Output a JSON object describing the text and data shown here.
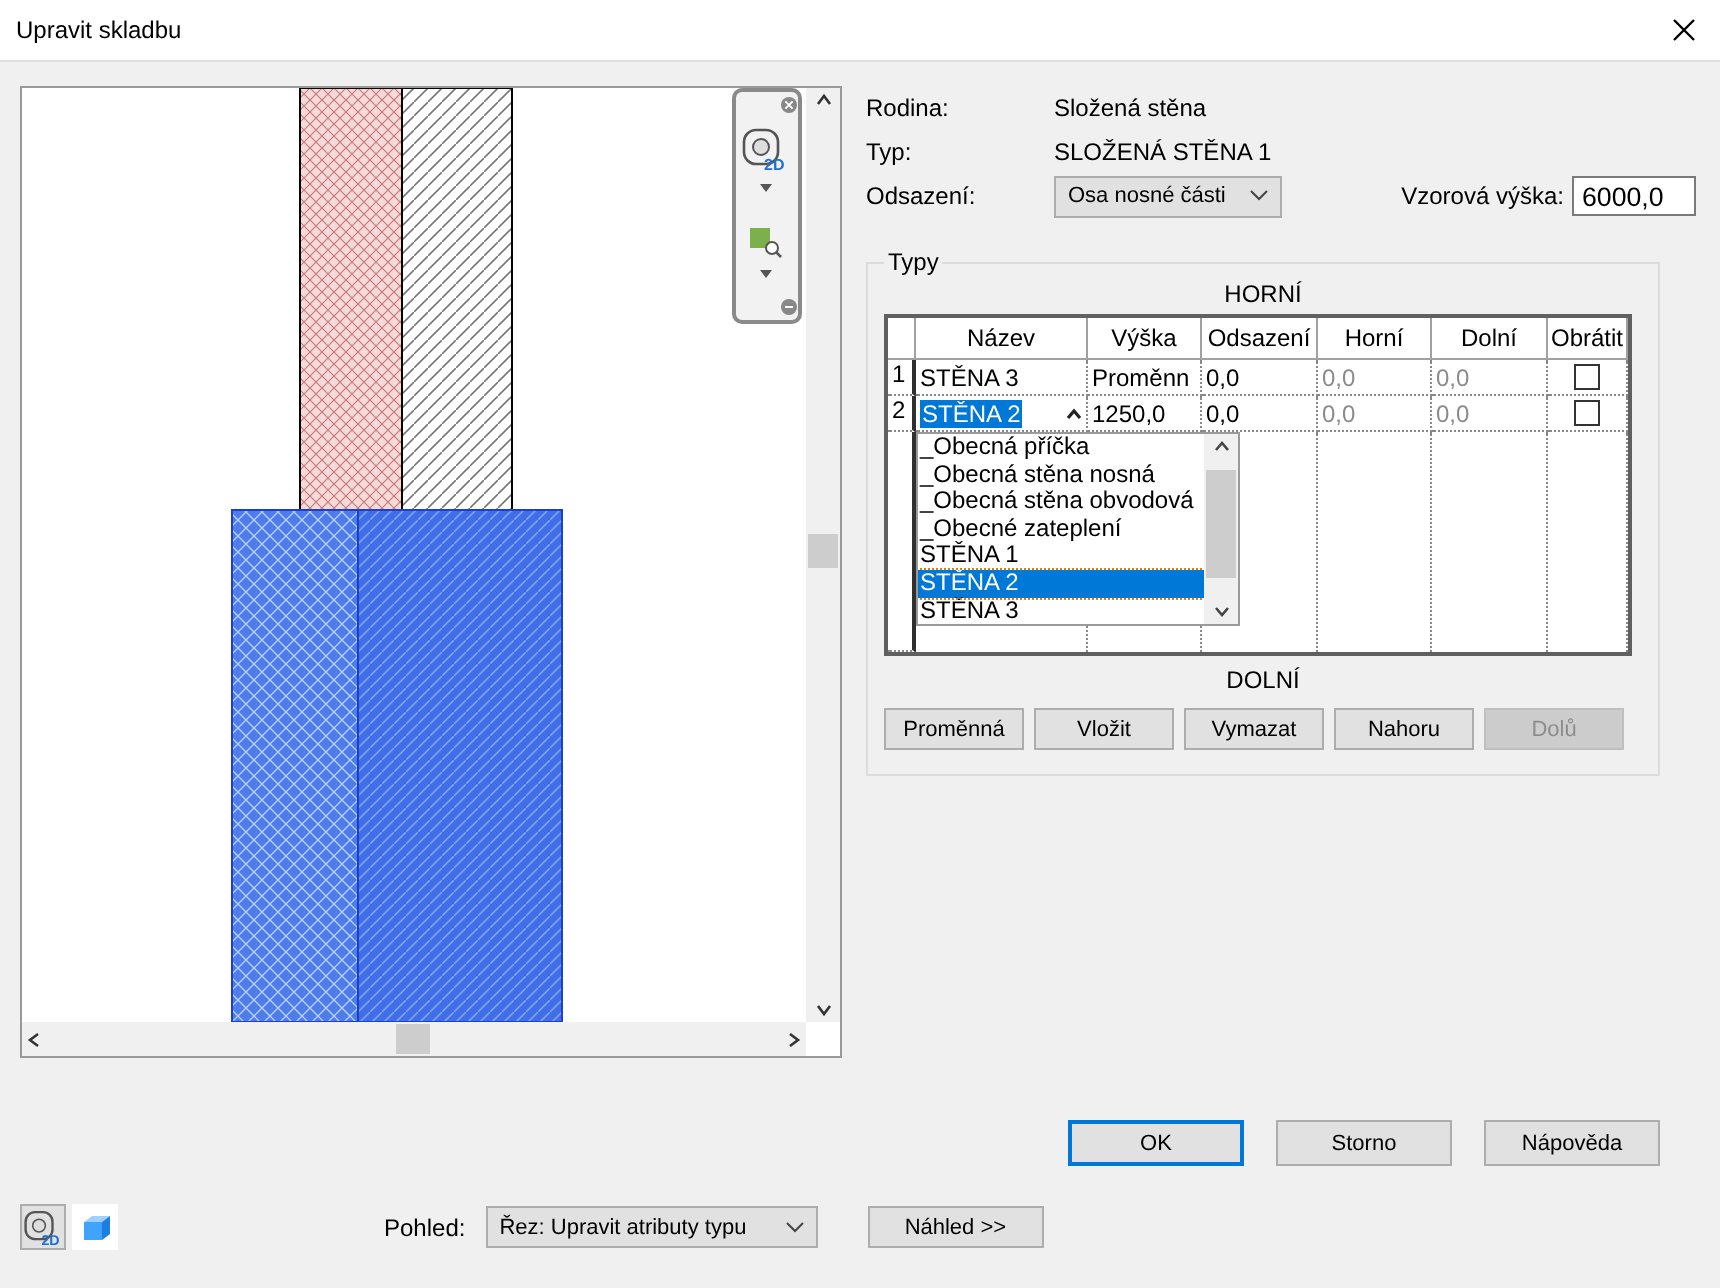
{
  "window": {
    "title": "Upravit skladbu"
  },
  "nav_bar": {
    "wheel_badge": "2D"
  },
  "properties": [
    {
      "label": "Rodina:",
      "value": "Složená stěna",
      "kind": "text"
    },
    {
      "label": "Typ:",
      "value": "SLOŽENÁ STĚNA 1",
      "kind": "text"
    },
    {
      "label": "Odsazení:",
      "value": "Osa nosné části",
      "kind": "select",
      "extra_label": "Vzorová výška:",
      "extra_value": "6000,0"
    }
  ],
  "types_group": {
    "title": "Typy",
    "top_label": "HORNÍ",
    "bottom_label": "DOLNÍ",
    "columns": [
      {
        "label": "Název",
        "dimmed": false
      },
      {
        "label": "Výška",
        "dimmed": false
      },
      {
        "label": "Odsazení",
        "dimmed": false
      },
      {
        "label": "Horní",
        "dimmed": true
      },
      {
        "label": "Dolní",
        "dimmed": true
      },
      {
        "label": "Obrátit",
        "dimmed": false
      }
    ],
    "rows": [
      {
        "number": "1",
        "cells": [
          "STĚNA 3",
          "Proměnn",
          "0,0",
          "0,0",
          "0,0"
        ],
        "flip_checked": false,
        "editing": false
      },
      {
        "number": "2",
        "cells": [
          "STĚNA 2",
          "1250,0",
          "0,0",
          "0,0",
          "0,0"
        ],
        "flip_checked": false,
        "editing": true
      }
    ],
    "dropdown": [
      {
        "label": "_Obecná příčka",
        "selected": false
      },
      {
        "label": "_Obecná stěna nosná",
        "selected": false
      },
      {
        "label": "_Obecná stěna obvodová",
        "selected": false
      },
      {
        "label": "_Obecné zateplení",
        "selected": false
      },
      {
        "label": "STĚNA 1",
        "selected": false
      },
      {
        "label": "STĚNA 2",
        "selected": true
      },
      {
        "label": "STĚNA 3",
        "selected": false
      }
    ],
    "buttons": [
      {
        "label": "Proměnná",
        "disabled": false
      },
      {
        "label": "Vložit",
        "disabled": false
      },
      {
        "label": "Vymazat",
        "disabled": false
      },
      {
        "label": "Nahoru",
        "disabled": false
      },
      {
        "label": "Dolů",
        "disabled": true
      }
    ]
  },
  "dialog_buttons": [
    {
      "label": "OK",
      "default": true
    },
    {
      "label": "Storno",
      "default": false
    },
    {
      "label": "Nápověda",
      "default": false
    }
  ],
  "footer": {
    "wheel_badge": "2D",
    "view_label": "Pohled:",
    "view_value": "Řez: Upravit atributy typu",
    "preview_button": "Náhled >>"
  }
}
